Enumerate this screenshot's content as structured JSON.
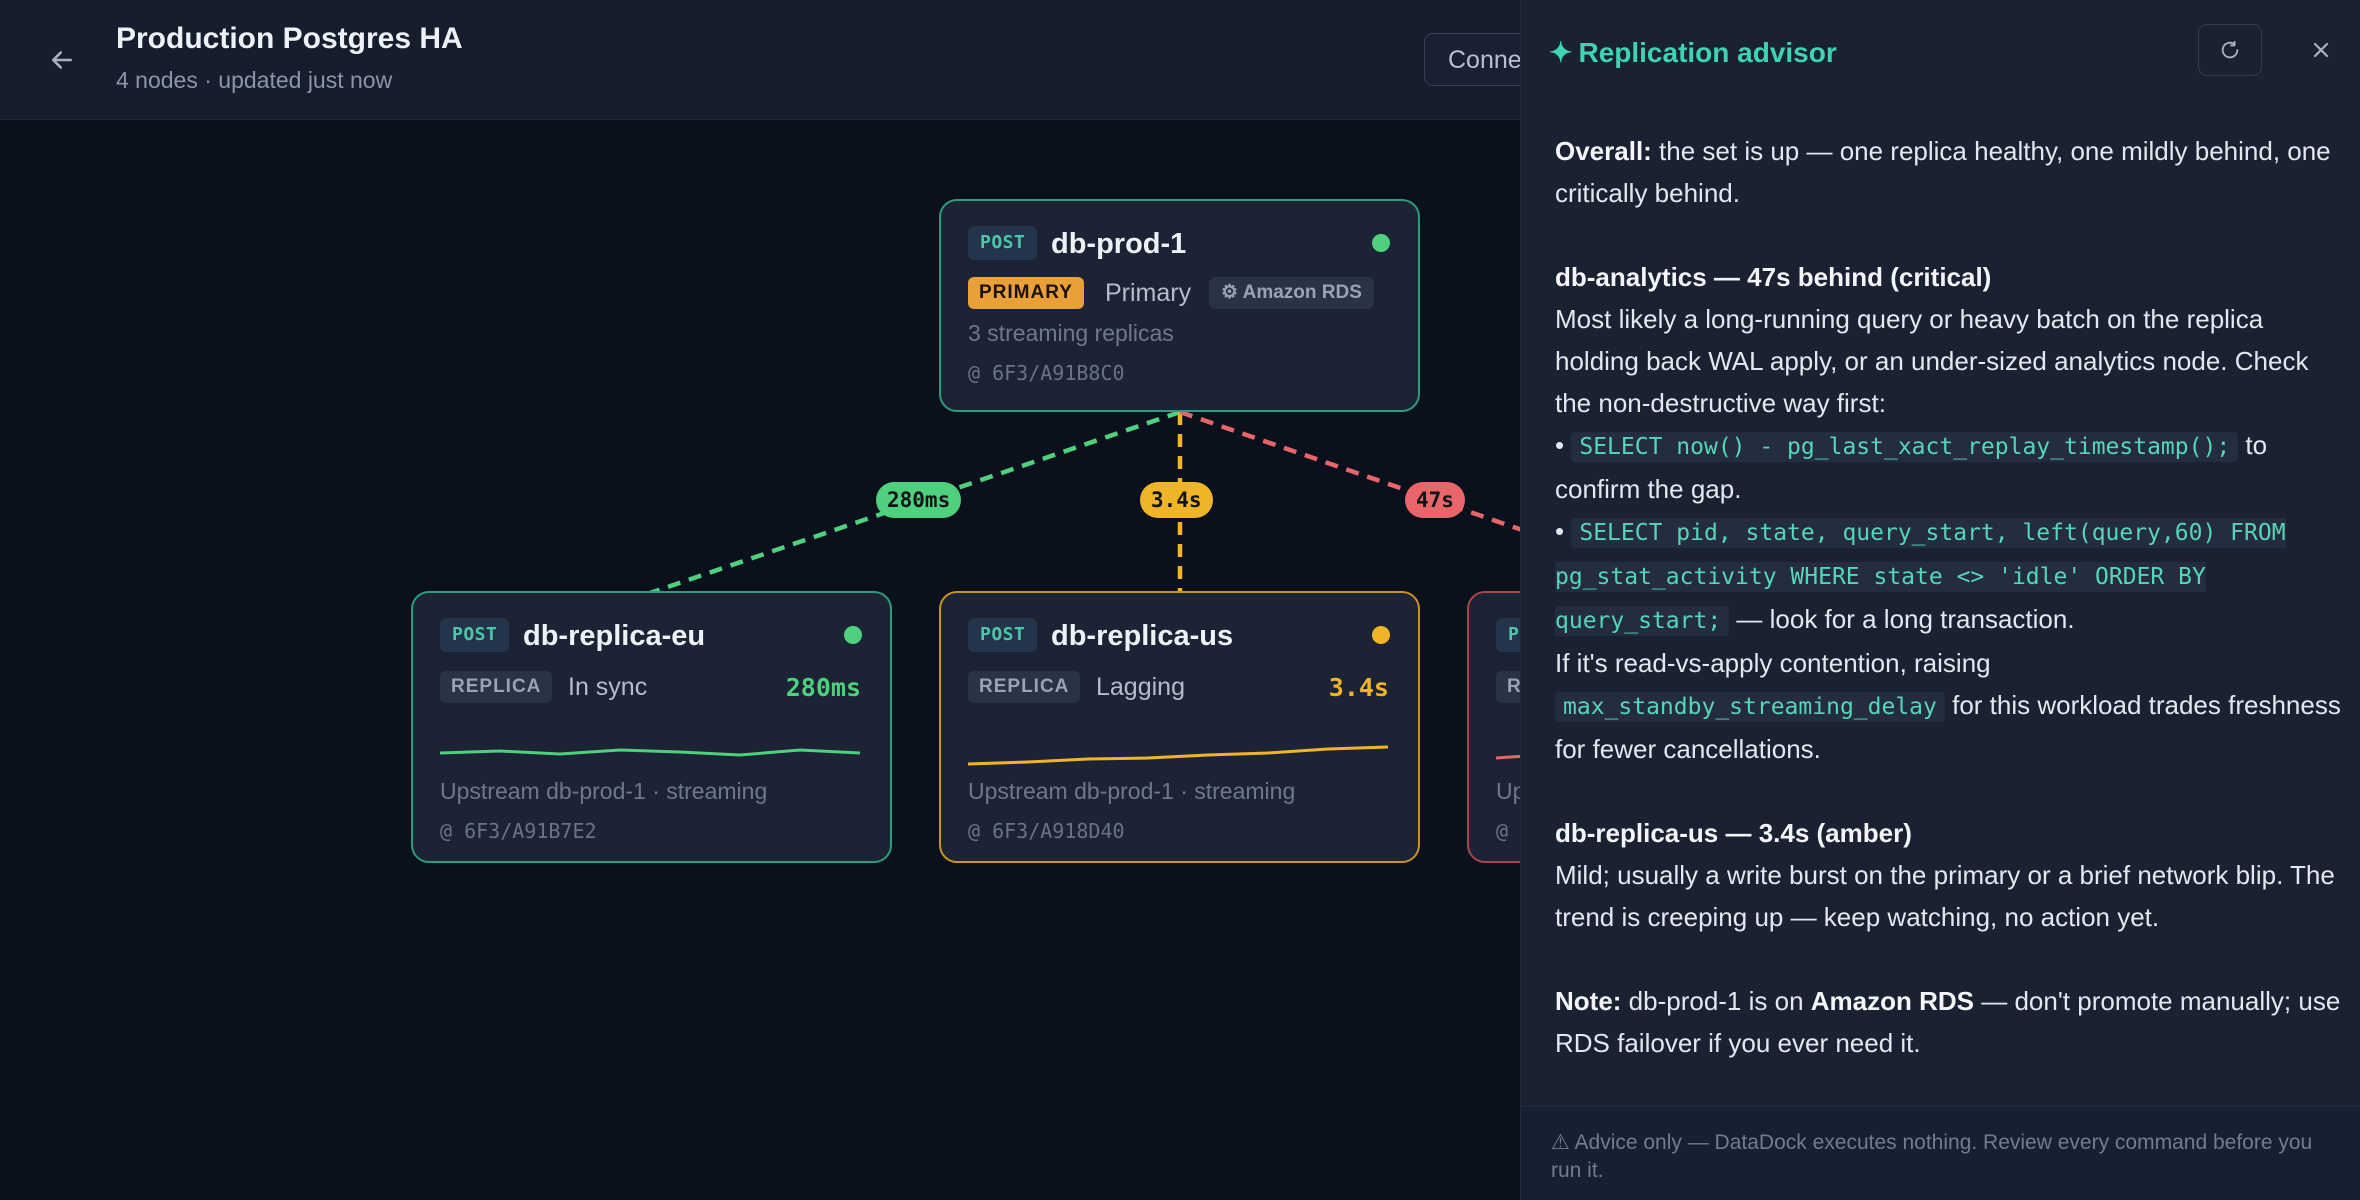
{
  "header": {
    "title": "Production Postgres HA",
    "subtitle": "4 nodes · updated just now",
    "connect_label": "Connect"
  },
  "colors": {
    "healthy": "#4fd07c",
    "warning": "#f0b429",
    "critical": "#e8666a",
    "accent": "#3fd3b1"
  },
  "edges": [
    {
      "label": "280ms",
      "status": "healthy"
    },
    {
      "label": "3.4s",
      "status": "warning"
    },
    {
      "label": "47s",
      "status": "critical"
    }
  ],
  "nodes": {
    "primary": {
      "kind": "POST",
      "name": "db-prod-1",
      "role": "PRIMARY",
      "status": "Primary",
      "provider": "Amazon RDS",
      "detail": "3 streaming replicas",
      "lsn": "@ 6F3/A91B8C0"
    },
    "replica_eu": {
      "kind": "POST",
      "name": "db-replica-eu",
      "role": "REPLICA",
      "status": "In sync",
      "lag": "280ms",
      "upstream": "Upstream db-prod-1 · streaming",
      "lsn": "@ 6F3/A91B7E2"
    },
    "replica_us": {
      "kind": "POST",
      "name": "db-replica-us",
      "role": "REPLICA",
      "status": "Lagging",
      "lag": "3.4s",
      "upstream": "Upstream db-prod-1 · streaming",
      "lsn": "@ 6F3/A918D40"
    },
    "replica_analytics": {
      "kind": "P",
      "role": "R",
      "upstream": "Up",
      "lsn": "@"
    }
  },
  "panel": {
    "title": "Replication advisor",
    "overall_label": "Overall:",
    "overall_text": " the set is up — one replica healthy, one mildly behind, one critically behind.",
    "analytics_heading": "db-analytics — 47s behind (critical)",
    "analytics_body": "Most likely a long-running query or heavy batch on the replica holding back WAL apply, or an under-sized analytics node. Check the non-destructive way first:",
    "bullet": "•",
    "code1": "SELECT now() - pg_last_xact_replay_timestamp();",
    "code1_after": " to confirm the gap.",
    "code2": "SELECT pid, state, query_start, left(query,60) FROM pg_stat_activity WHERE state <> 'idle' ORDER BY query_start;",
    "code2_after": " — look for a long transaction.",
    "contention_before": "If it's read-vs-apply contention, raising ",
    "code3": "max_standby_streaming_delay",
    "contention_after": " for this workload trades freshness for fewer cancellations.",
    "us_heading": "db-replica-us — 3.4s (amber)",
    "us_body": "Mild; usually a write burst on the primary or a brief network blip. The trend is creeping up — keep watching, no action yet.",
    "note_label": "Note:",
    "note_before": " db-prod-1 is on ",
    "note_bold": "Amazon RDS",
    "note_after": " — don't promote manually; use RDS failover if you ever need it.",
    "footer": "⚠ Advice only — DataDock executes nothing. Review every command before you run it."
  }
}
